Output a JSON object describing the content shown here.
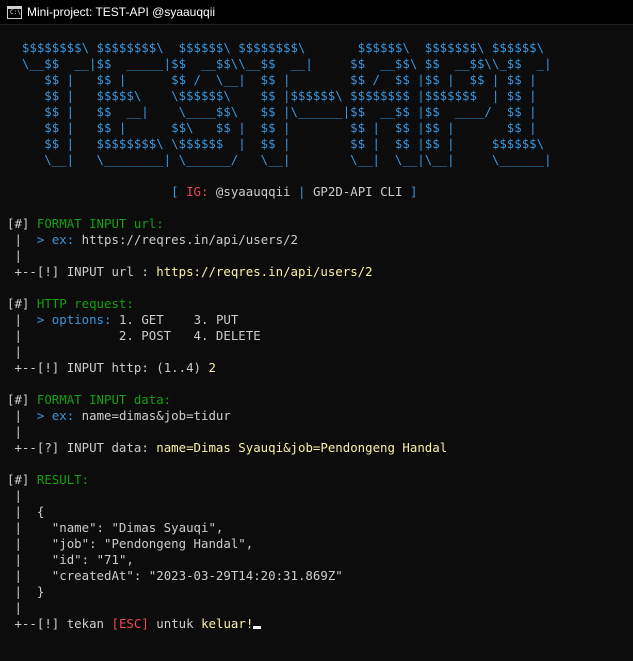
{
  "window": {
    "title": "Mini-project: TEST-API @syaauqqii",
    "icon_label": "C:\\"
  },
  "banner": [
    "  $$$$$$$$\\ $$$$$$$$\\  $$$$$$\\ $$$$$$$$\\       $$$$$$\\  $$$$$$$\\ $$$$$$\\",
    "  \\__$$  __|$$  _____|$$  __$$\\\\__$$  __|     $$  __$$\\ $$  __$$\\\\_$$  _|",
    "     $$ |   $$ |      $$ /  \\__|  $$ |        $$ /  $$ |$$ |  $$ | $$ |",
    "     $$ |   $$$$$\\    \\$$$$$$\\    $$ |$$$$$$\\ $$$$$$$$ |$$$$$$$  | $$ |",
    "     $$ |   $$  __|    \\____$$\\   $$ |\\______|$$  __$$ |$$  ____/  $$ |",
    "     $$ |   $$ |      $$\\   $$ |  $$ |        $$ |  $$ |$$ |       $$ |",
    "     $$ |   $$$$$$$$\\ \\$$$$$$  |  $$ |        $$ |  $$ |$$ |     $$$$$$\\",
    "     \\__|   \\________| \\______/   \\__|        \\__|  \\__|\\__|     \\______|"
  ],
  "credits": {
    "open": "[",
    "ig_label": "IG:",
    "handle": "@syaauqqii",
    "sep": "|",
    "cli": "GP2D-API CLI",
    "close": "]"
  },
  "steps": {
    "url": {
      "tag": "[#]",
      "heading": "FORMAT INPUT url:",
      "hint_key": "ex:",
      "hint_value": "https://reqres.in/api/users/2",
      "prompt_tag": "[!]",
      "prompt_label": "INPUT url :",
      "value": "https://reqres.in/api/users/2"
    },
    "http": {
      "tag": "[#]",
      "heading": "HTTP request:",
      "hint_key": "options:",
      "options": [
        "1. GET",
        "3. PUT",
        "2. POST",
        "4. DELETE"
      ],
      "prompt_tag": "[!]",
      "prompt_label": "INPUT http: (1..4)",
      "value": "2"
    },
    "data": {
      "tag": "[#]",
      "heading": "FORMAT INPUT data:",
      "hint_key": "ex:",
      "hint_value": "name=dimas&job=tidur",
      "prompt_tag": "[?]",
      "prompt_label": "INPUT data:",
      "value": "name=Dimas Syauqi&job=Pendongeng Handal"
    },
    "result": {
      "tag": "[#]",
      "heading": "RESULT:",
      "open_brace": "{",
      "close_brace": "}",
      "fields": [
        {
          "key": "\"name\":",
          "value": "\"Dimas Syauqi\","
        },
        {
          "key": "\"job\":",
          "value": "\"Pendongeng Handal\","
        },
        {
          "key": "\"id\":",
          "value": "\"71\","
        },
        {
          "key": "\"createdAt\":",
          "value": "\"2023-03-29T14:20:31.869Z\""
        }
      ],
      "exit_tag": "[!]",
      "exit_pre": "tekan",
      "exit_key": "[ESC]",
      "exit_mid": "untuk",
      "exit_post": "keluar!"
    }
  }
}
